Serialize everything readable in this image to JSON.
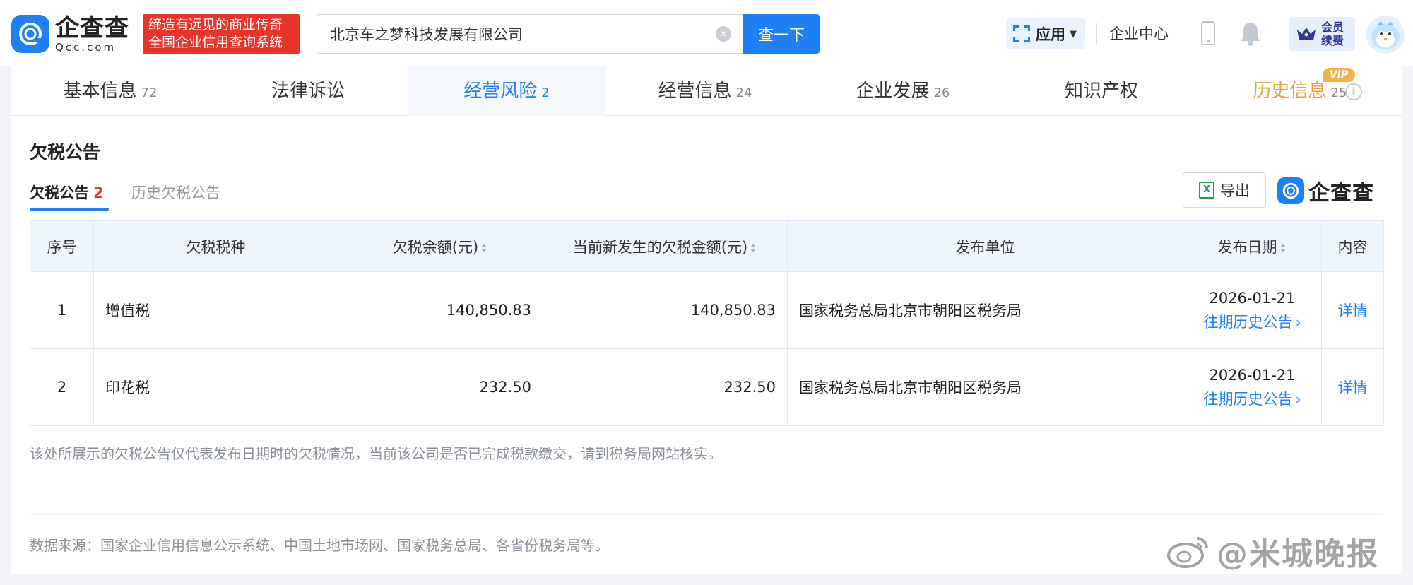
{
  "header": {
    "logo_name": "企查查",
    "logo_domain": "Qcc.com",
    "slogan_line1": "缔造有远见的商业传奇",
    "slogan_line2": "全国企业信用查询系统",
    "search_value": "北京车之梦科技发展有限公司",
    "search_button": "查一下",
    "apps_label": "应用",
    "enterprise_center": "企业中心",
    "vip_line1": "会员",
    "vip_line2": "续费"
  },
  "tabs": [
    {
      "label": "基本信息",
      "count": "72"
    },
    {
      "label": "法律诉讼",
      "count": ""
    },
    {
      "label": "经营风险",
      "count": "2"
    },
    {
      "label": "经营信息",
      "count": "24"
    },
    {
      "label": "企业发展",
      "count": "26"
    },
    {
      "label": "知识产权",
      "count": ""
    },
    {
      "label": "历史信息",
      "count": "25"
    }
  ],
  "vip_badge": "VIP",
  "section": {
    "title": "欠税公告",
    "subtab_active": "欠税公告",
    "subtab_active_count": "2",
    "subtab_history": "历史欠税公告",
    "export_label": "导出",
    "brand_name": "企查查"
  },
  "table": {
    "headers": [
      "序号",
      "欠税税种",
      "欠税余额(元)",
      "当前新发生的欠税金额(元)",
      "发布单位",
      "发布日期",
      "内容"
    ],
    "rows": [
      {
        "index": "1",
        "tax_type": "增值税",
        "balance": "140,850.83",
        "new_amount": "140,850.83",
        "publisher": "国家税务总局北京市朝阳区税务局",
        "date": "2026-01-21",
        "history_link": "往期历史公告",
        "detail": "详情"
      },
      {
        "index": "2",
        "tax_type": "印花税",
        "balance": "232.50",
        "new_amount": "232.50",
        "publisher": "国家税务总局北京市朝阳区税务局",
        "date": "2026-01-21",
        "history_link": "往期历史公告",
        "detail": "详情"
      }
    ]
  },
  "note": "该处所展示的欠税公告仅代表发布日期时的欠税情况，当前该公司是否已完成税款缴交，请到税务局网站核实。",
  "source": "数据来源：国家企业信用信息公示系统、中国土地市场网、国家税务总局、各省份税务局等。",
  "watermark": "@米城晚报",
  "colors": {
    "accent": "#1f7ff4",
    "slogan_bg": "#e8342b",
    "history_tab": "#e6a23c",
    "count_red": "#e8342b"
  }
}
